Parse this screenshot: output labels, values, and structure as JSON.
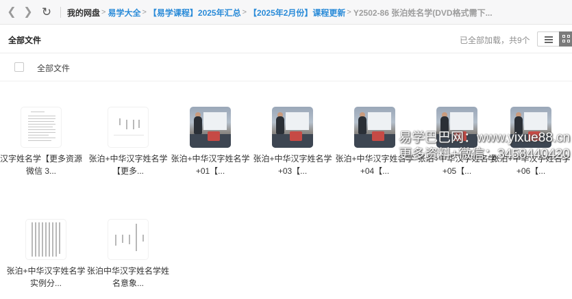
{
  "nav": {
    "breadcrumbs_root": "我的网盘",
    "breadcrumbs": [
      "易学大全",
      "【易学课程】2025年汇总",
      "【2025年2月份】课程更新"
    ],
    "current_folder": "Y2502-86 张泊姓名学(DVD格式需下..."
  },
  "header": {
    "title": "全部文件",
    "load_status": "已全部加载，共9个"
  },
  "select_all": {
    "label": "全部文件"
  },
  "files": [
    {
      "name": "汉字姓名学【更多资源 微信 3...",
      "thumb": "doc"
    },
    {
      "name": "张泊+中华汉字姓名学【更多...",
      "thumb": "doc-cover"
    },
    {
      "name": "张泊+中华汉字姓名学+01【...",
      "thumb": "video"
    },
    {
      "name": "张泊+中华汉字姓名学+03【...",
      "thumb": "video"
    },
    {
      "name": "张泊+中华汉字姓名学+04【...",
      "thumb": "video"
    },
    {
      "name": "张泊+中华汉字姓名学+05【...",
      "thumb": "video"
    },
    {
      "name": "张泊+中华汉字姓名学+06【...",
      "thumb": "video"
    },
    {
      "name": "张泊+中华汉字姓名学实例分...",
      "thumb": "doc-dense"
    },
    {
      "name": "张泊中华汉字姓名学姓名意象...",
      "thumb": "doc-sparse"
    }
  ],
  "watermark": {
    "line1": "易学巴巴网：www.yixue88.cn",
    "line2": "更多资料+微信：3458440420"
  }
}
